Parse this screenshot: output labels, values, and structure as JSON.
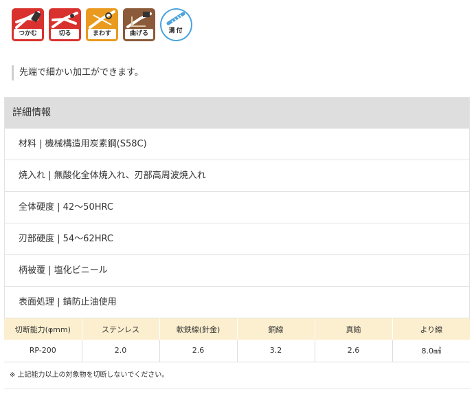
{
  "feature_icons": [
    {
      "label": "つかむ",
      "icon": "grip-icon",
      "color": "#d9322e"
    },
    {
      "label": "切る",
      "icon": "cut-icon",
      "color": "#d9322e"
    },
    {
      "label": "まわす",
      "icon": "twist-icon",
      "color": "#e99a1f"
    },
    {
      "label": "曲げる",
      "icon": "bend-icon",
      "color": "#8a5a3a"
    },
    {
      "label": "溝付",
      "icon": "groove-icon",
      "color": "#4aa3df"
    }
  ],
  "lead_text": "先端で細かい加工ができます。",
  "details": {
    "header": "詳細情報",
    "rows": [
      "材料 | 機械構造用炭素鋼(S58C)",
      "焼入れ | 無酸化全体焼入れ、刃部高周波焼入れ",
      "全体硬度 | 42～50HRC",
      "刃部硬度 | 54～62HRC",
      "柄被覆 | 塩化ビニール",
      "表面処理 | 錆防止油使用"
    ]
  },
  "capacity_table": {
    "headers": [
      "切断能力(φmm)",
      "ステンレス",
      "軟鉄線(針金)",
      "銅線",
      "真鍮",
      "より線"
    ],
    "rows": [
      [
        "RP-200",
        "2.0",
        "2.6",
        "3.2",
        "2.6",
        "8.0㎟"
      ]
    ],
    "header_bg": "#fcefcf"
  },
  "note": "※ 上記能力以上の対象物を切断しないでください。"
}
